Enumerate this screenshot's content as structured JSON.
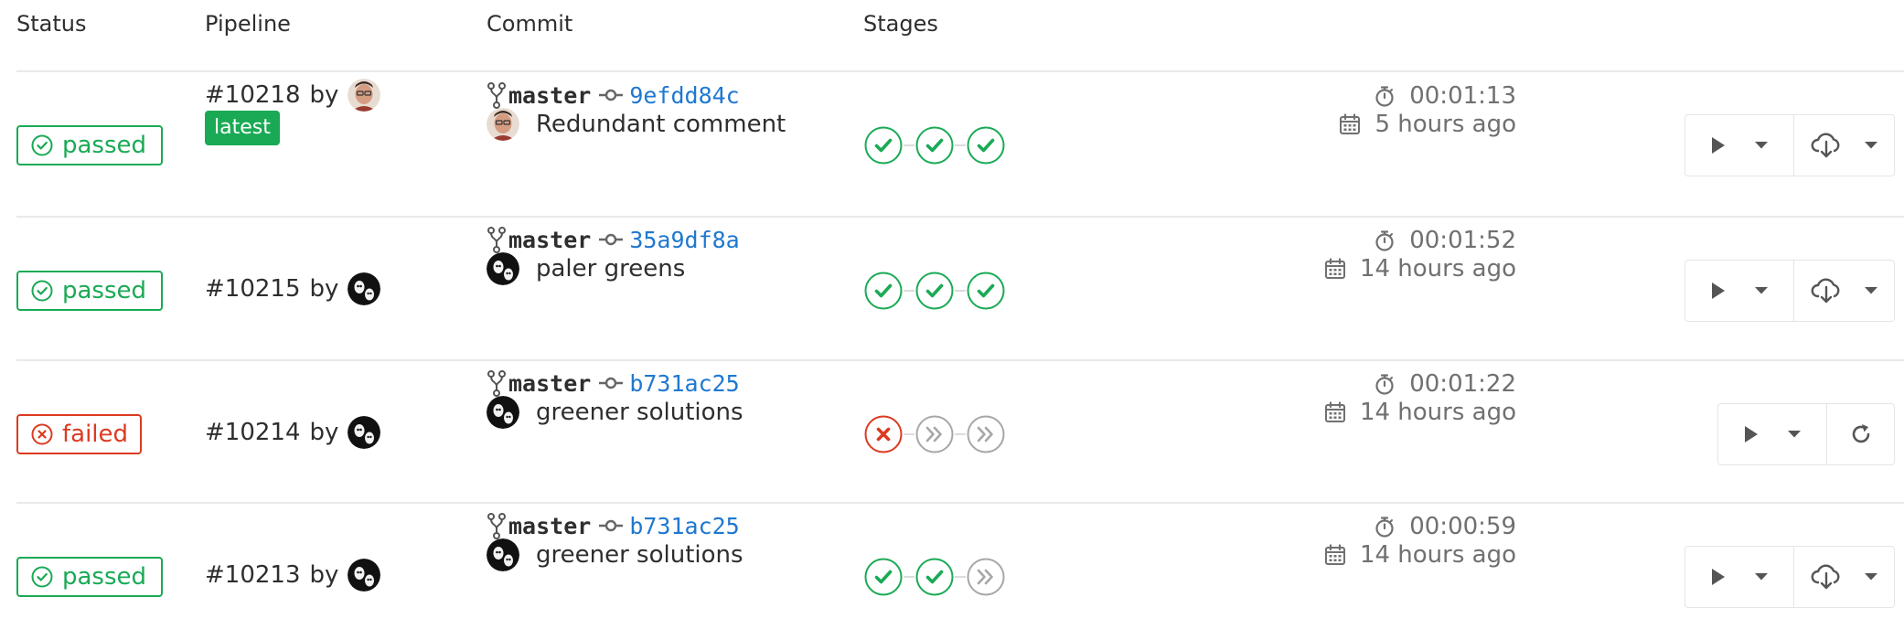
{
  "headers": {
    "status": "Status",
    "pipeline": "Pipeline",
    "commit": "Commit",
    "stages": "Stages"
  },
  "colors": {
    "success": "#1aaa55",
    "failed": "#db3b21",
    "link": "#1f78d1",
    "muted": "#707070"
  },
  "pipelines": [
    {
      "status": "passed",
      "id": "#10218",
      "by": "by",
      "avatar": "user-avatar-photo",
      "latest": "latest",
      "branch": "master",
      "sha": "9efdd84c",
      "message": "Redundant comment",
      "stages": [
        "success",
        "success",
        "success"
      ],
      "duration": "00:01:13",
      "finished": "5 hours ago",
      "actions": [
        "play",
        "artifacts"
      ]
    },
    {
      "status": "passed",
      "id": "#10215",
      "by": "by",
      "avatar": "user-avatar-dark",
      "branch": "master",
      "sha": "35a9df8a",
      "message": "paler greens",
      "stages": [
        "success",
        "success",
        "success"
      ],
      "duration": "00:01:52",
      "finished": "14 hours ago",
      "actions": [
        "play",
        "artifacts"
      ]
    },
    {
      "status": "failed",
      "id": "#10214",
      "by": "by",
      "avatar": "user-avatar-dark",
      "branch": "master",
      "sha": "b731ac25",
      "message": "greener solutions",
      "stages": [
        "failed",
        "skipped",
        "skipped"
      ],
      "duration": "00:01:22",
      "finished": "14 hours ago",
      "actions": [
        "play",
        "retry"
      ]
    },
    {
      "status": "passed",
      "id": "#10213",
      "by": "by",
      "avatar": "user-avatar-dark",
      "branch": "master",
      "sha": "b731ac25",
      "message": "greener solutions",
      "stages": [
        "success",
        "success",
        "skipped"
      ],
      "duration": "00:00:59",
      "finished": "14 hours ago",
      "actions": [
        "play",
        "artifacts"
      ]
    }
  ]
}
